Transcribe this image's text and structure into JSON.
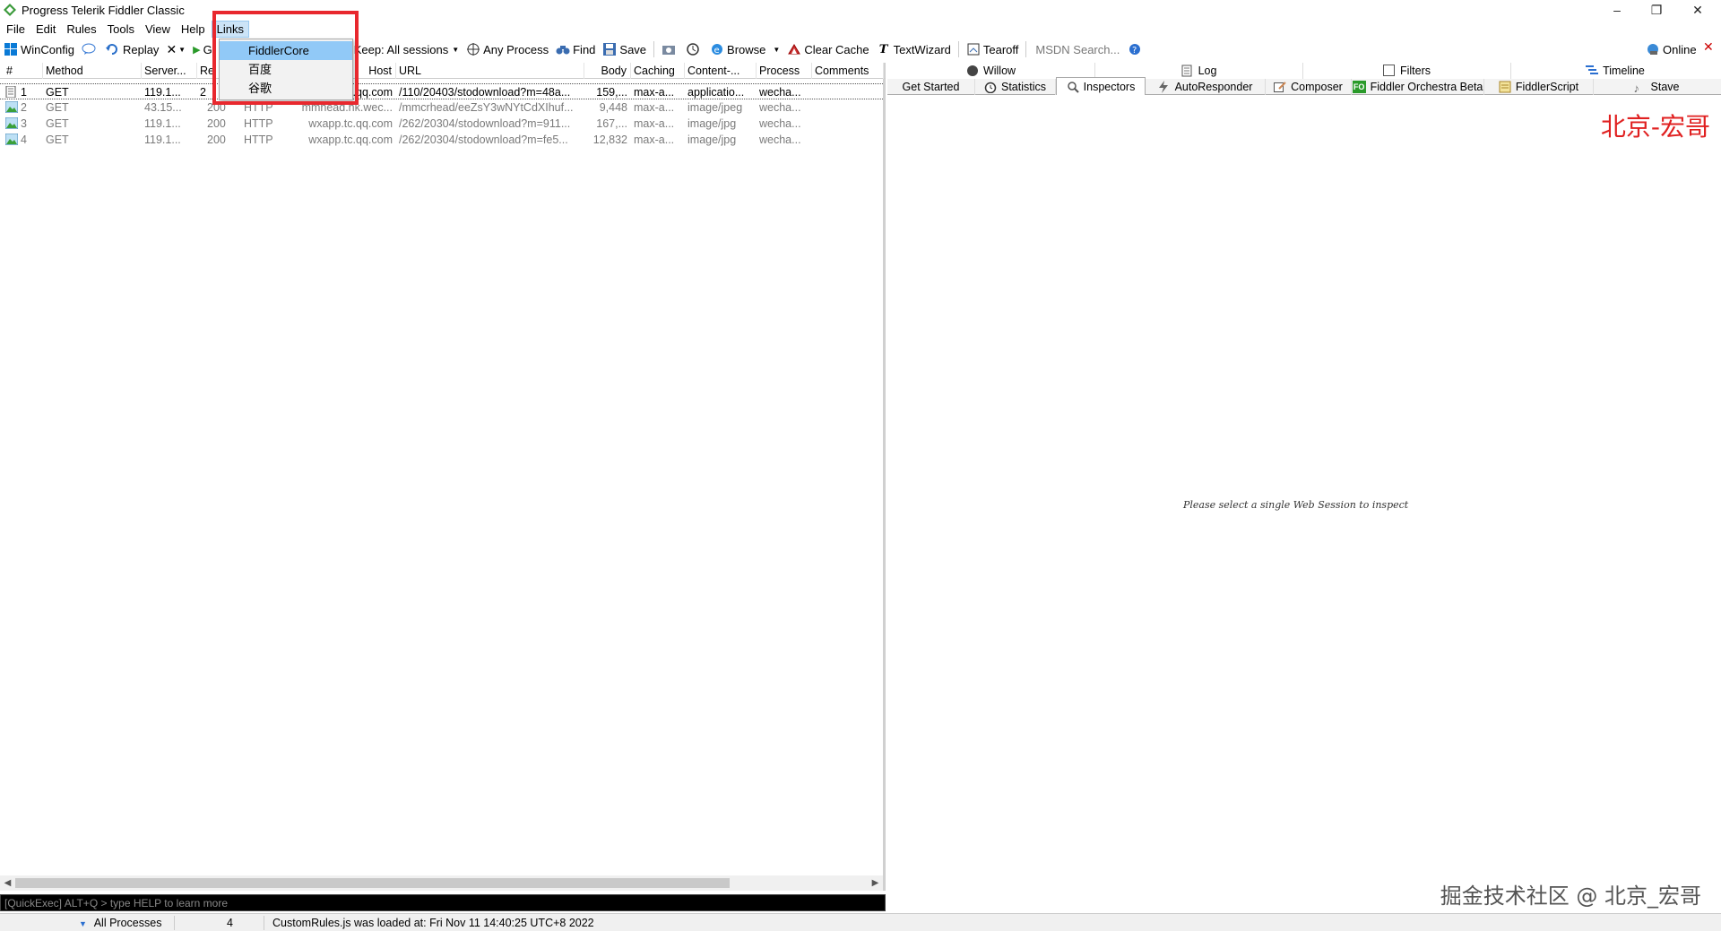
{
  "window": {
    "title": "Progress Telerik Fiddler Classic",
    "minimize": "–",
    "restore": "❐",
    "close": "✕"
  },
  "menu": {
    "items": [
      "File",
      "Edit",
      "Rules",
      "Tools",
      "View",
      "Help",
      "Links"
    ],
    "active": "Links",
    "dropdown": [
      "FiddlerCore",
      "百度",
      "谷歌"
    ]
  },
  "toolbar": {
    "winconfig": "WinConfig",
    "replay": "Replay",
    "remove": "✕",
    "go_partial": "G",
    "keep": "Keep: All sessions",
    "any_process": "Any Process",
    "find": "Find",
    "save": "Save",
    "browse": "Browse",
    "clear_cache": "Clear Cache",
    "textwizard": "TextWizard",
    "tearoff": "Tearoff",
    "msdn_search": "MSDN Search...",
    "online": "Online"
  },
  "sessions": {
    "columns": [
      "#",
      "Method",
      "Server...",
      "Re",
      "Host",
      "URL",
      "Body",
      "Caching",
      "Content-...",
      "Process",
      "Comments"
    ],
    "rows": [
      {
        "num": "1",
        "method": "GET",
        "server": "119.1...",
        "result": "2",
        "protocol": "",
        "host": "...qq.com",
        "url": "/110/20403/stodownload?m=48a...",
        "body": "159,...",
        "caching": "max-a...",
        "content": "applicatio...",
        "process": "wecha...",
        "comments": ""
      },
      {
        "num": "2",
        "method": "GET",
        "server": "43.15...",
        "result": "200",
        "protocol": "HTTP",
        "host": "mmhead.hk.wec...",
        "url": "/mmcrhead/eeZsY3wNYtCdXIhuf...",
        "body": "9,448",
        "caching": "max-a...",
        "content": "image/jpeg",
        "process": "wecha...",
        "comments": ""
      },
      {
        "num": "3",
        "method": "GET",
        "server": "119.1...",
        "result": "200",
        "protocol": "HTTP",
        "host": "wxapp.tc.qq.com",
        "url": "/262/20304/stodownload?m=911...",
        "body": "167,...",
        "caching": "max-a...",
        "content": "image/jpg",
        "process": "wecha...",
        "comments": ""
      },
      {
        "num": "4",
        "method": "GET",
        "server": "119.1...",
        "result": "200",
        "protocol": "HTTP",
        "host": "wxapp.tc.qq.com",
        "url": "/262/20304/stodownload?m=fe5...",
        "body": "12,832",
        "caching": "max-a...",
        "content": "image/jpg",
        "process": "wecha...",
        "comments": ""
      }
    ],
    "quickexec": "[QuickExec] ALT+Q > type HELP to learn more"
  },
  "tabs": {
    "top": [
      "Willow",
      "Log",
      "Filters",
      "Timeline"
    ],
    "bottom": [
      "Get Started",
      "Statistics",
      "Inspectors",
      "AutoResponder",
      "Composer",
      "Fiddler Orchestra Beta",
      "FiddlerScript",
      "Stave"
    ],
    "active": "Inspectors",
    "orchestra_badge": "FO"
  },
  "inspector": {
    "message": "Please select a single Web Session to inspect"
  },
  "watermarks": {
    "top": "北京-宏哥",
    "bottom": "掘金技术社区 @ 北京_宏哥"
  },
  "status": {
    "processes": "All Processes",
    "count": "4",
    "message": "CustomRules.js was loaded at: Fri Nov 11 14:40:25 UTC+8 2022"
  },
  "colors": {
    "accent_red": "#e8282e",
    "menu_highlight": "#91c9f7"
  }
}
